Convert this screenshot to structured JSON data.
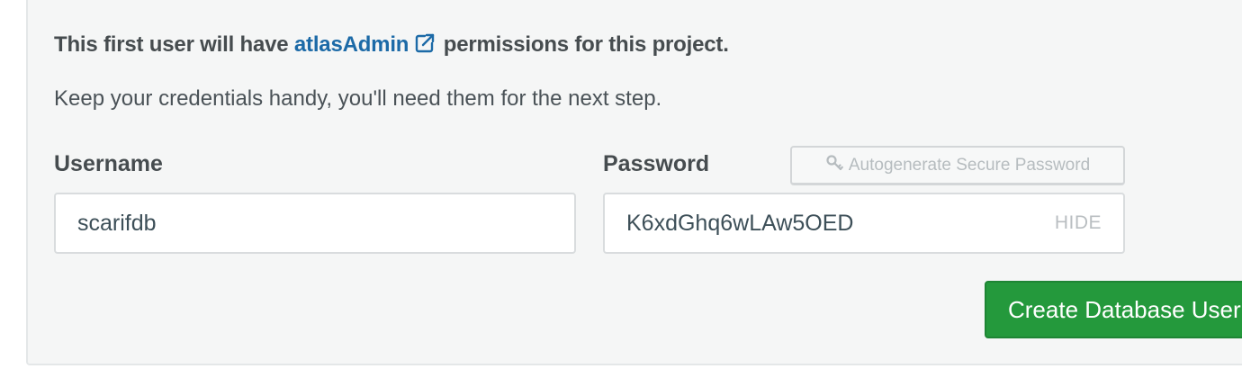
{
  "intro": {
    "prefix": "This first user will have ",
    "link_text": "atlasAdmin",
    "suffix": " permissions for this project."
  },
  "hint": "Keep your credentials handy, you'll need them for the next step.",
  "username": {
    "label": "Username",
    "value": "scarifdb"
  },
  "password": {
    "label": "Password",
    "value": "K6xdGhq6wLAw5OED",
    "toggle_label": "HIDE",
    "autogenerate_label": "Autogenerate Secure Password"
  },
  "actions": {
    "create_label": "Create Database User"
  },
  "colors": {
    "link": "#1c6aa7",
    "primary_button": "#24993c",
    "panel_background": "#f5f6f6"
  },
  "icons": {
    "link": "external-link-icon",
    "autogenerate": "key-icon"
  }
}
